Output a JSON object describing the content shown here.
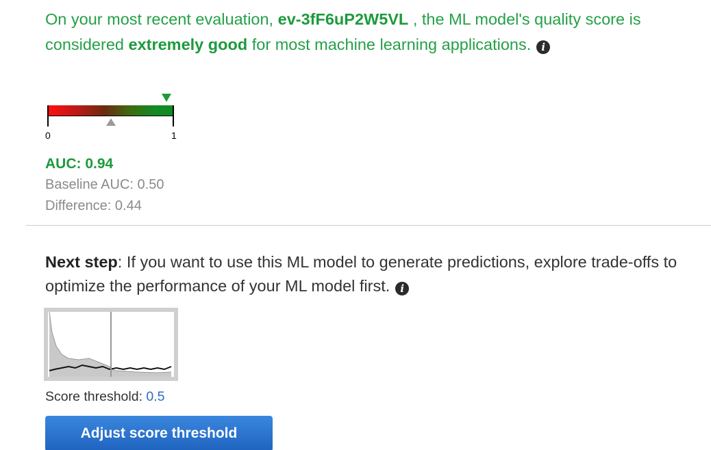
{
  "evaluation": {
    "text_prefix": "On your most recent evaluation,",
    "eval_id": "ev-3fF6uP2W5VL",
    "text_middle": ", the ML model's quality score is considered",
    "quality": "extremely good",
    "text_suffix": "for most machine learning applications.",
    "info_icon": "info-icon"
  },
  "gauge": {
    "min_label": "0",
    "max_label": "1",
    "value": 0.94,
    "baseline": 0.5,
    "colors": {
      "low": "#ff1010",
      "high": "#108a20",
      "marker": "#1d9a3d",
      "baseline_marker": "#9a9a9a"
    }
  },
  "metrics": {
    "auc": "AUC: 0.94",
    "baseline": "Baseline AUC: 0.50",
    "difference": "Difference: 0.44"
  },
  "next_step": {
    "label": "Next step",
    "text": ": If you want to use this ML model to generate predictions, explore trade-offs to optimize the performance of your ML model first.",
    "info_icon": "info-icon"
  },
  "threshold": {
    "label": "Score threshold:",
    "value": "0.5"
  },
  "buttons": {
    "adjust": "Adjust score threshold"
  },
  "colors": {
    "good": "#1d9a3d",
    "muted": "#8a8a8a",
    "link": "#2a6cc2",
    "button": "#1f64c0"
  }
}
